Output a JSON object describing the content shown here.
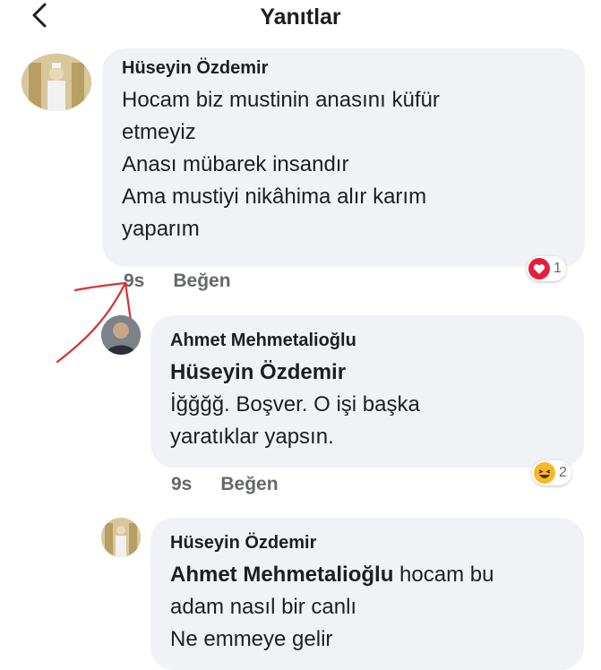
{
  "header": {
    "title": "Yanıtlar",
    "back_icon": "chevron-left-icon"
  },
  "comments": [
    {
      "author": "Hüseyin Özdemir",
      "lines": [
        "Hocam biz mustinin anasını küfür",
        "etmeyiz",
        "Anası mübarek insandır",
        "Ama mustiyi nikâhima alır karım",
        "yaparım"
      ],
      "time": "9s",
      "like": "Beğen",
      "reaction": {
        "icon": "heart-icon",
        "color": "#e41e3f",
        "count": "1"
      }
    },
    {
      "author": "Ahmet Mehmetalioğlu",
      "mention": "Hüseyin Özdemir",
      "lines": [
        "İğğğğ. Boşver. O işi başka",
        "yaratıklar yapsın."
      ],
      "time": "9s",
      "like": "Beğen",
      "reaction": {
        "icon": "laughing-emoji-icon",
        "color": "#f7b928",
        "count": "2"
      }
    },
    {
      "author": "Hüseyin Özdemir",
      "mention": "Ahmet Mehmetalioğlu",
      "first_line_rest": " hocam bu",
      "lines": [
        "adam nasıl bir canlı",
        "Ne emmeye gelir"
      ]
    }
  ]
}
